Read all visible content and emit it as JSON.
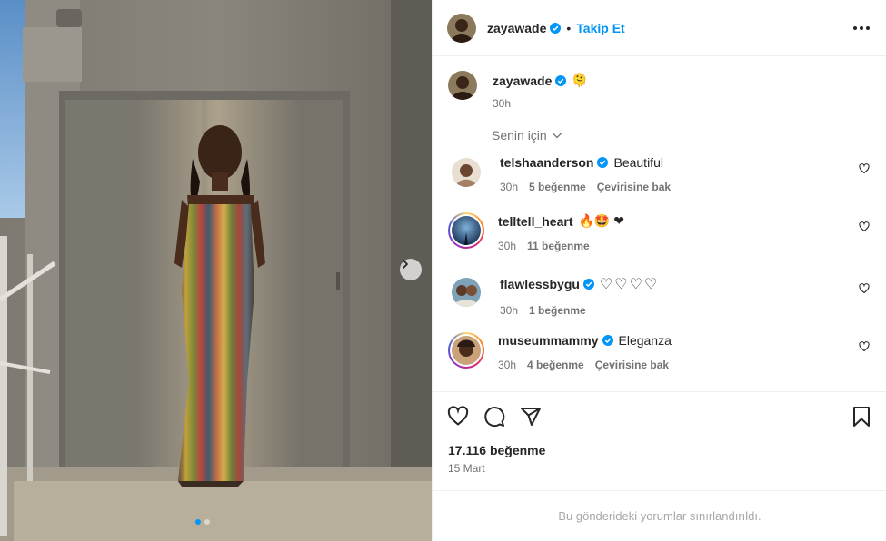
{
  "post": {
    "author": "zayawade",
    "follow_label": "Takip Et",
    "separator": "•",
    "caption_emoji": "🫠",
    "caption_time": "30h",
    "sort_label": "Senin için",
    "likes": "17.116 beğenme",
    "date": "15 Mart",
    "comments_limited": "Bu gönderideki yorumlar sınırlandırıldı."
  },
  "comments": [
    {
      "user": "telshaanderson",
      "verified": true,
      "text": "Beautiful",
      "time": "30h",
      "likes": "5 beğenme",
      "translate": "Çevirisine bak",
      "ring": false
    },
    {
      "user": "telltell_heart",
      "verified": false,
      "text": "🔥🤩 ❤",
      "time": "30h",
      "likes": "11 beğenme",
      "translate": "",
      "ring": true
    },
    {
      "user": "flawlessbygu",
      "verified": true,
      "text": "♡♡♡♡",
      "time": "30h",
      "likes": "1 beğenme",
      "translate": "",
      "ring": false
    },
    {
      "user": "museummammy",
      "verified": true,
      "text": "Eleganza",
      "time": "30h",
      "likes": "4 beğenme",
      "translate": "Çevirisine bak",
      "ring": true
    }
  ],
  "icons": {
    "verified": "verified-badge-icon",
    "more": "more-options-icon",
    "next": "chevron-right-icon",
    "like": "heart-icon",
    "comment": "comment-bubble-icon",
    "share": "paper-plane-icon",
    "save": "bookmark-icon"
  },
  "colors": {
    "accent": "#0095f6",
    "text": "#262626",
    "secondary": "#737373",
    "divider": "#efefef"
  }
}
